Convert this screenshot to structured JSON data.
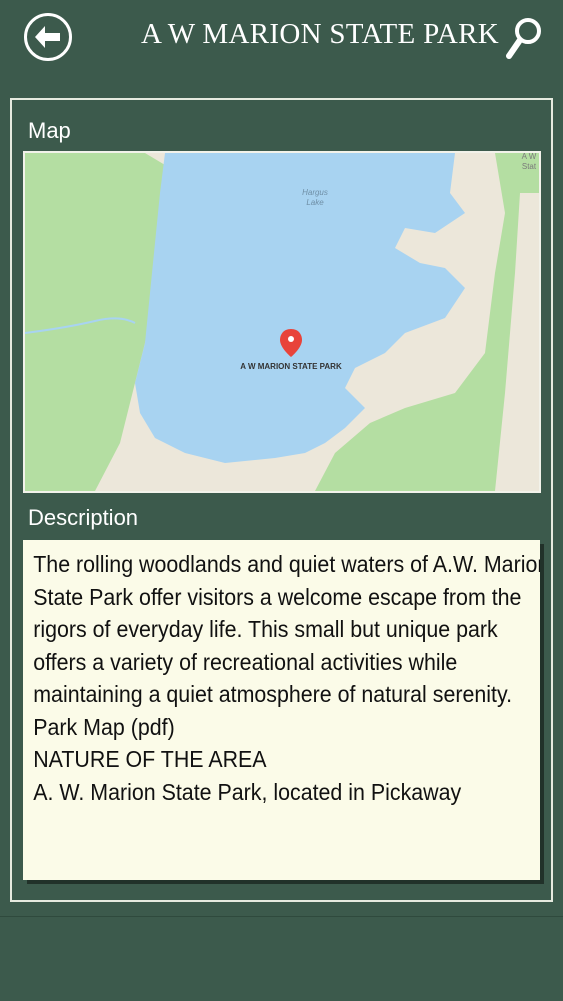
{
  "header": {
    "title": "A W MARION STATE PARK",
    "back_icon": "back-arrow-icon",
    "search_icon": "search-icon"
  },
  "map_section": {
    "label": "Map",
    "lake_label_line1": "Hargus",
    "lake_label_line2": "Lake",
    "marker_label": "A W MARION STATE PARK",
    "corner_label_line1": "A W",
    "corner_label_line2": "Stat",
    "marker_icon": "map-pin-icon"
  },
  "description_section": {
    "label": "Description",
    "paragraphs": [
      "The rolling woodlands and quiet waters of A.W. Marion State Park offer visitors a welcome escape from the rigors of everyday life. This small but unique park offers a variety of recreational activities while maintaining a quiet atmosphere of natural serenity.",
      "Park Map (pdf)",
      "NATURE OF THE AREA",
      "A. W. Marion State Park, located in Pickaway"
    ]
  },
  "colors": {
    "background": "#3c5a4c",
    "panel_border": "#e6eadf",
    "description_bg": "#fbfbe8",
    "water": "#a8d3f1",
    "forest": "#b4dea2",
    "land": "#ece7da",
    "marker": "#e8433a"
  }
}
